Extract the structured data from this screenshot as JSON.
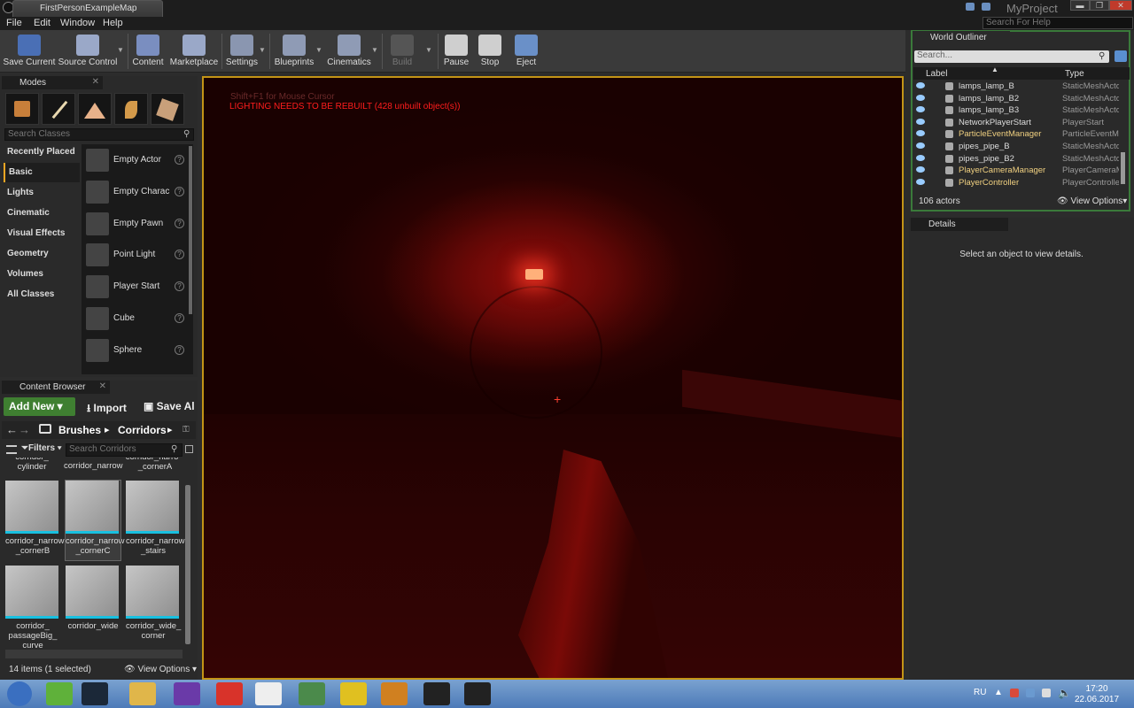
{
  "window": {
    "tab_title": "FirstPersonExampleMap",
    "project": "MyProject",
    "search_help": "Search For Help",
    "min": "▬",
    "max": "❐",
    "close": "✕"
  },
  "menu": [
    "File",
    "Edit",
    "Window",
    "Help"
  ],
  "toolbar": [
    {
      "label": "Save Current",
      "icon": "save-icon",
      "color": "#4a6fb5"
    },
    {
      "label": "Source Control",
      "icon": "source-control-icon",
      "color": "#9aa8c8"
    },
    {
      "label": "Content",
      "icon": "content-icon",
      "color": "#7a8ec0"
    },
    {
      "label": "Marketplace",
      "icon": "marketplace-icon",
      "color": "#9aa8c8"
    },
    {
      "label": "Settings",
      "icon": "settings-icon",
      "color": "#8a96b0"
    },
    {
      "label": "Blueprints",
      "icon": "blueprints-icon",
      "color": "#8f9bb5"
    },
    {
      "label": "Cinematics",
      "icon": "cinematics-icon",
      "color": "#8f9bb5"
    },
    {
      "label": "Build",
      "icon": "build-icon",
      "color": "#555"
    },
    {
      "label": "Pause",
      "icon": "pause-icon",
      "color": "#cfcfcf"
    },
    {
      "label": "Stop",
      "icon": "stop-icon",
      "color": "#cfcfcf"
    },
    {
      "label": "Eject",
      "icon": "eject-icon",
      "color": "#6a90c8"
    }
  ],
  "modes": {
    "title": "Modes",
    "search_placeholder": "Search Classes",
    "categories": [
      "Recently Placed",
      "Basic",
      "Lights",
      "Cinematic",
      "Visual Effects",
      "Geometry",
      "Volumes",
      "All Classes"
    ],
    "selected_category": "Basic",
    "classes": [
      "Empty Actor",
      "Empty Charac",
      "Empty Pawn",
      "Point Light",
      "Player Start",
      "Cube",
      "Sphere"
    ]
  },
  "content_browser": {
    "title": "Content Browser",
    "add_new": "Add New ▾",
    "import": "Import",
    "save_all": "Save Al",
    "path": [
      "Brushes",
      "Corridors"
    ],
    "filters": "Filters",
    "search_placeholder": "Search Corridors",
    "top_row": [
      "corridor_\ncylinder",
      "corridor_narrow",
      "corridor_narrow\n_cornerA"
    ],
    "assets": [
      "corridor_narrow\n_cornerB",
      "corridor_narrow\n_cornerC",
      "corridor_narrow\n_stairs",
      "corridor_\npassageBig_\ncurve",
      "corridor_wide",
      "corridor_wide_\ncorner"
    ],
    "selected_asset": "corridor_narrow _cornerC",
    "status": "14 items (1 selected)",
    "view_options": "View Options"
  },
  "viewport": {
    "hint": "Shift+F1 for Mouse Cursor",
    "warning": "LIGHTING NEEDS TO BE REBUILT (428 unbuilt object(s))"
  },
  "outliner": {
    "title": "World Outliner",
    "search_placeholder": "Search...",
    "col_label": "Label",
    "col_type": "Type",
    "rows": [
      {
        "name": "lamps_lamp_B",
        "type": "StaticMeshActor",
        "hl": false
      },
      {
        "name": "lamps_lamp_B2",
        "type": "StaticMeshActor",
        "hl": false
      },
      {
        "name": "lamps_lamp_B3",
        "type": "StaticMeshActor",
        "hl": false
      },
      {
        "name": "NetworkPlayerStart",
        "type": "PlayerStart",
        "hl": false
      },
      {
        "name": "ParticleEventManager",
        "type": "ParticleEventM",
        "hl": true
      },
      {
        "name": "pipes_pipe_B",
        "type": "StaticMeshActor",
        "hl": false
      },
      {
        "name": "pipes_pipe_B2",
        "type": "StaticMeshActor",
        "hl": false
      },
      {
        "name": "PlayerCameraManager",
        "type": "PlayerCameraM",
        "hl": true
      },
      {
        "name": "PlayerController",
        "type": "PlayerControlle",
        "hl": true
      }
    ],
    "count": "106 actors",
    "view_options": "View Options"
  },
  "details": {
    "title": "Details",
    "empty": "Select an object to view details."
  },
  "taskbar": {
    "lang": "RU",
    "time": "17:20",
    "date": "22.06.2017",
    "apps": [
      {
        "name": "start-icon",
        "color": "#3a6fc0"
      },
      {
        "name": "utorrent-icon",
        "color": "#5fb13a"
      },
      {
        "name": "steam-icon",
        "color": "#1b2838"
      },
      {
        "name": "explorer-icon",
        "color": "#e0b64a"
      },
      {
        "name": "visual-studio-icon",
        "color": "#6a3aa8"
      },
      {
        "name": "chrome-icon",
        "color": "#d8332a"
      },
      {
        "name": "yandex-icon",
        "color": "#eeeeee"
      },
      {
        "name": "task-manager-icon",
        "color": "#4b8a4b"
      },
      {
        "name": "plus-app-icon",
        "color": "#e0c020"
      },
      {
        "name": "csgo-icon",
        "color": "#d08020"
      },
      {
        "name": "epic-games-icon",
        "color": "#222222"
      },
      {
        "name": "unreal-editor-icon",
        "color": "#222222"
      }
    ]
  }
}
